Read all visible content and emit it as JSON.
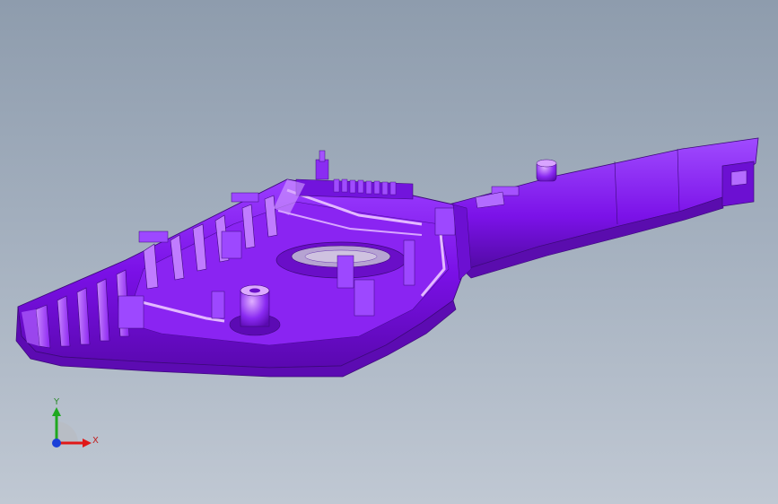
{
  "viewport": {
    "background_top": "#8e9cad",
    "background_bottom": "#c0c8d3",
    "model_color": "#7a10e6",
    "model_highlight": "#c277ff"
  },
  "model": {
    "name": "plastic-housing-part",
    "icon": "3d-part-icon"
  },
  "triad": {
    "y_label": "Y",
    "x_label": "X",
    "y_color": "#1fa81f",
    "x_color": "#e01818",
    "z_color": "#1a3fd8"
  }
}
